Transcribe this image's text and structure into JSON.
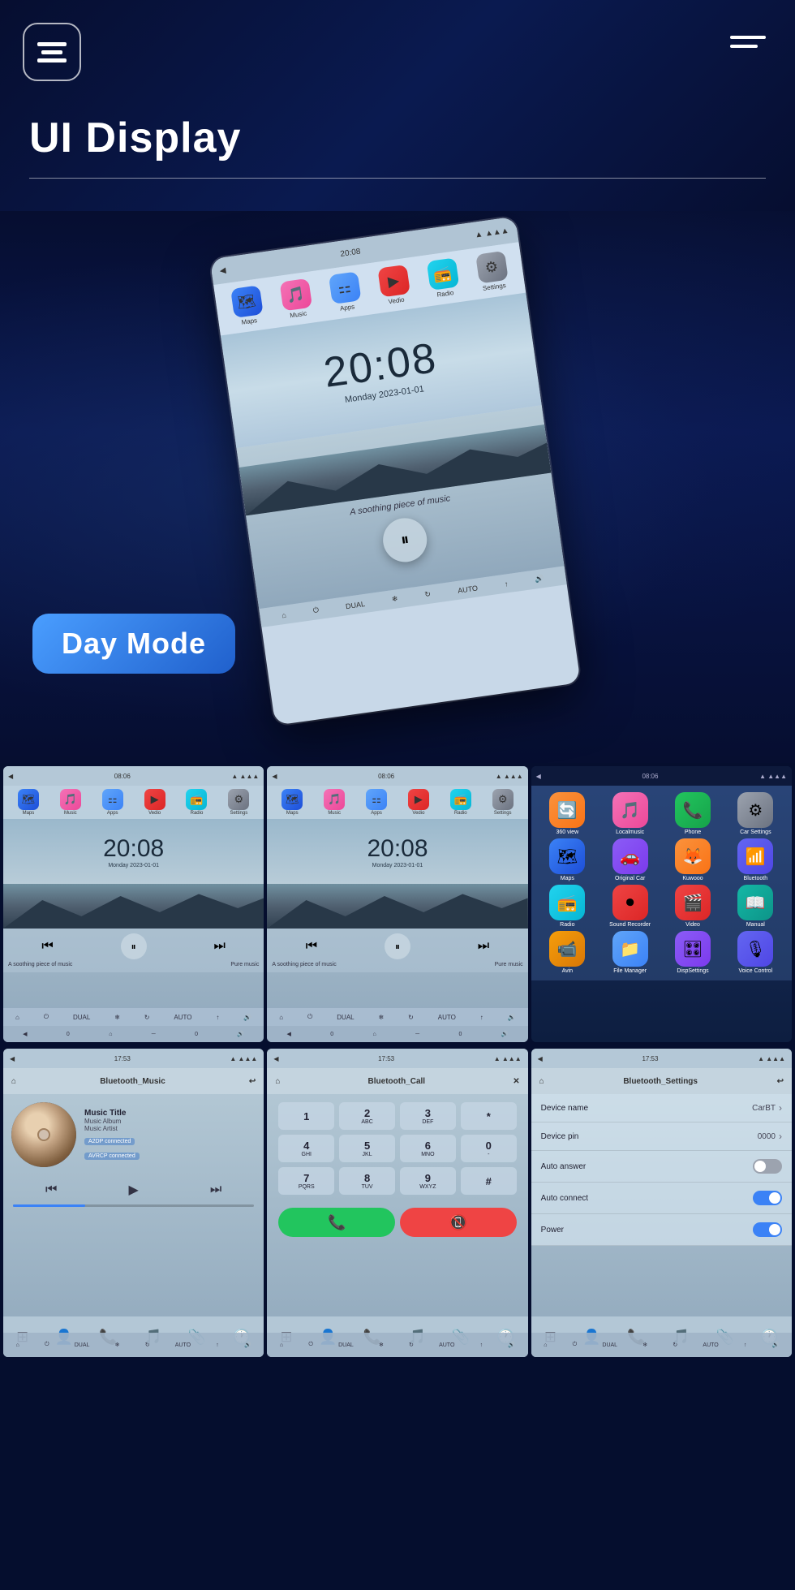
{
  "header": {
    "title": "UI Display",
    "logo_label": "Menu Logo",
    "hamburger_label": "Menu"
  },
  "hero": {
    "phone": {
      "time": "20:08",
      "date": "Monday  2023-01-01",
      "music_text": "A soothing piece of music",
      "nav_apps": [
        {
          "label": "Maps",
          "icon": "🗺",
          "color": "app-blue"
        },
        {
          "label": "Music",
          "icon": "🎵",
          "color": "app-pink"
        },
        {
          "label": "Apps",
          "icon": "⚏",
          "color": "app-blue2"
        },
        {
          "label": "Vedio",
          "icon": "▶",
          "color": "app-red"
        },
        {
          "label": "Radio",
          "icon": "📻",
          "color": "app-cyan"
        },
        {
          "label": "Settings",
          "icon": "⚙",
          "color": "app-gray"
        }
      ]
    },
    "badge": "Day Mode"
  },
  "top_grid": [
    {
      "id": "sc1",
      "type": "home",
      "top_time": "08:06",
      "phone_time": "20:08",
      "phone_date": "Monday  2023-01-01",
      "music_text": "A soothing piece of music",
      "music_text2": "Pure music"
    },
    {
      "id": "sc2",
      "type": "home",
      "top_time": "08:06",
      "phone_time": "20:08",
      "phone_date": "Monday  2023-01-01",
      "music_text": "A soothing piece of music",
      "music_text2": "Pure music"
    },
    {
      "id": "sc3",
      "type": "apps",
      "top_time": "08:06",
      "apps": [
        {
          "label": "360 view",
          "icon": "🔄",
          "color": "app-orange"
        },
        {
          "label": "Localmusic",
          "icon": "🎵",
          "color": "app-pink"
        },
        {
          "label": "Phone",
          "icon": "📞",
          "color": "app-green"
        },
        {
          "label": "Car Settings",
          "icon": "⚙",
          "color": "app-gray"
        },
        {
          "label": "Maps",
          "icon": "🗺",
          "color": "app-blue"
        },
        {
          "label": "Original Car",
          "icon": "🚗",
          "color": "app-violet"
        },
        {
          "label": "Kuwooo",
          "icon": "🦊",
          "color": "app-orange"
        },
        {
          "label": "Bluetooth",
          "icon": "📶",
          "color": "app-indigo"
        },
        {
          "label": "Radio",
          "icon": "📻",
          "color": "app-cyan"
        },
        {
          "label": "Sound Recorder",
          "icon": "⏺",
          "color": "app-red"
        },
        {
          "label": "Video",
          "icon": "🎬",
          "color": "app-red"
        },
        {
          "label": "Manual",
          "icon": "📖",
          "color": "app-teal"
        },
        {
          "label": "Avin",
          "icon": "📹",
          "color": "app-yellow"
        },
        {
          "label": "File Manager",
          "icon": "📁",
          "color": "app-blue2"
        },
        {
          "label": "DispSettings",
          "icon": "🎛",
          "color": "app-violet"
        },
        {
          "label": "Voice Control",
          "icon": "🎙",
          "color": "app-indigo"
        }
      ]
    }
  ],
  "bt_grid": [
    {
      "id": "bt1",
      "type": "bluetooth_music",
      "title": "Bluetooth_Music",
      "top_time": "17:53",
      "music_title": "Music Title",
      "music_album": "Music Album",
      "music_artist": "Music Artist",
      "tag1": "A2DP connected",
      "tag2": "AVRCP connected"
    },
    {
      "id": "bt2",
      "type": "bluetooth_call",
      "title": "Bluetooth_Call",
      "top_time": "17:53",
      "keys": [
        "1",
        "2 ABC",
        "3 DEF",
        "*",
        "4 GHI",
        "5 JKL",
        "6 MNO",
        "0 -",
        "7 PQRS",
        "8 TUV",
        "9 WXYZ",
        "#"
      ]
    },
    {
      "id": "bt3",
      "type": "bluetooth_settings",
      "title": "Bluetooth_Settings",
      "top_time": "17:53",
      "settings": [
        {
          "label": "Device name",
          "value": "CarBT",
          "type": "nav"
        },
        {
          "label": "Device pin",
          "value": "0000",
          "type": "nav"
        },
        {
          "label": "Auto answer",
          "value": "",
          "type": "toggle",
          "state": "off"
        },
        {
          "label": "Auto connect",
          "value": "",
          "type": "toggle",
          "state": "on"
        },
        {
          "label": "Power",
          "value": "",
          "type": "toggle",
          "state": "on"
        }
      ]
    }
  ],
  "icons": {
    "back": "◀",
    "home": "⌂",
    "power": "⏻",
    "dual": "DUAL",
    "snow": "❄",
    "loop": "↻",
    "auto": "AUTO",
    "wifi": "↑",
    "volume": "🔊",
    "prev": "⏮",
    "play_pause": "⏸",
    "next": "⏭",
    "menu": "☰",
    "phone": "📞",
    "music": "♪",
    "attach": "📎",
    "clock": "🕐"
  }
}
